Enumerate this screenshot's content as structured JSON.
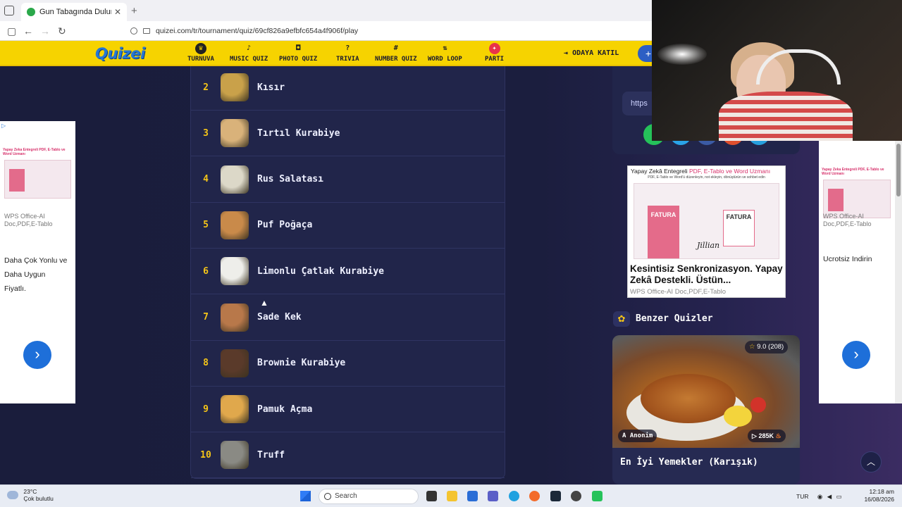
{
  "browser": {
    "tab_title": "Gun Tabagında Dulunan Lezzetl",
    "url": "quizei.com/tr/tournament/quiz/69cf826a9efbfc654a4f906f/play"
  },
  "site": {
    "logo": "Quizei",
    "nav": [
      {
        "label": "TURNUVA",
        "icon": "trophy-icon"
      },
      {
        "label": "MUSIC QUIZ",
        "icon": "music-icon"
      },
      {
        "label": "PHOTO QUIZ",
        "icon": "camera-icon"
      },
      {
        "label": "TRIVIA",
        "icon": "question-icon"
      },
      {
        "label": "NUMBER QUIZ",
        "icon": "hash-icon"
      },
      {
        "label": "WORD LOOP",
        "icon": "sort-icon"
      },
      {
        "label": "PARTI",
        "icon": "party-icon"
      }
    ],
    "join_room": "ODAYA KATIL"
  },
  "ranking": [
    {
      "rank": "2",
      "name": "Kısır",
      "color": "#c9a14a"
    },
    {
      "rank": "3",
      "name": "Tırtıl Kurabiye",
      "color": "#d9b27a"
    },
    {
      "rank": "4",
      "name": "Rus Salatası",
      "color": "#dcd8c8"
    },
    {
      "rank": "5",
      "name": "Puf Poğaça",
      "color": "#c98a4a"
    },
    {
      "rank": "6",
      "name": "Limonlu Çatlak Kurabiye",
      "color": "#eeeeea"
    },
    {
      "rank": "7",
      "name": "Sade Kek",
      "color": "#b8784a"
    },
    {
      "rank": "8",
      "name": "Brownie Kurabiye",
      "color": "#5a3a2a"
    },
    {
      "rank": "9",
      "name": "Pamuk Açma",
      "color": "#e0a84c"
    },
    {
      "rank": "10",
      "name": "Truff",
      "color": "#8a8a84"
    }
  ],
  "ads": {
    "left": {
      "head": "Yapay Zeka Entegreli PDF, E-Tablo ve Word Uzmanı",
      "small": "WPS Office-AI Doc,PDF,E-Tablo",
      "text_lines": [
        "Daha Çok Yonlu ve",
        "Daha Uygun",
        "Fiyatlı."
      ]
    },
    "right_side": {
      "head": "Yapay Zeka Entegreli PDF, E-Tablo ve Word Uzmanı",
      "small": "WPS Office-AI Doc,PDF,E-Tablo",
      "text": "Ucrotsiz Indirin"
    },
    "center": {
      "head_prefix": "Yapay Zekâ Entegreli",
      "head_mid": "PDF, E-Tablo ve Word Uzmanı",
      "sub": "PDF, E-Tablo ve Word'ü düzenleyin, not ekleyin, dönüştürün ve sohbet edin",
      "fatura": "FATURA",
      "signature": "Jillian",
      "title": "Kesintisiz Senkronizasyon. Yapay Zekâ Destekli. Üstün...",
      "foot": "WPS Office-AI Doc,PDF,E-Tablo"
    }
  },
  "share": {
    "url_label": "https"
  },
  "similar": {
    "title": "Benzer Quizler",
    "card": {
      "rating": "9.0",
      "rating_count": "(208)",
      "author": "Anonim",
      "author_initial": "A",
      "plays": "285K",
      "name": "En İyi Yemekler (Karışık)"
    }
  },
  "taskbar": {
    "temp": "23°C",
    "weather": "Çok bulutlu",
    "search": "Search",
    "lang": "TUR",
    "time": "12:18 am",
    "date": "16/08/2026"
  }
}
